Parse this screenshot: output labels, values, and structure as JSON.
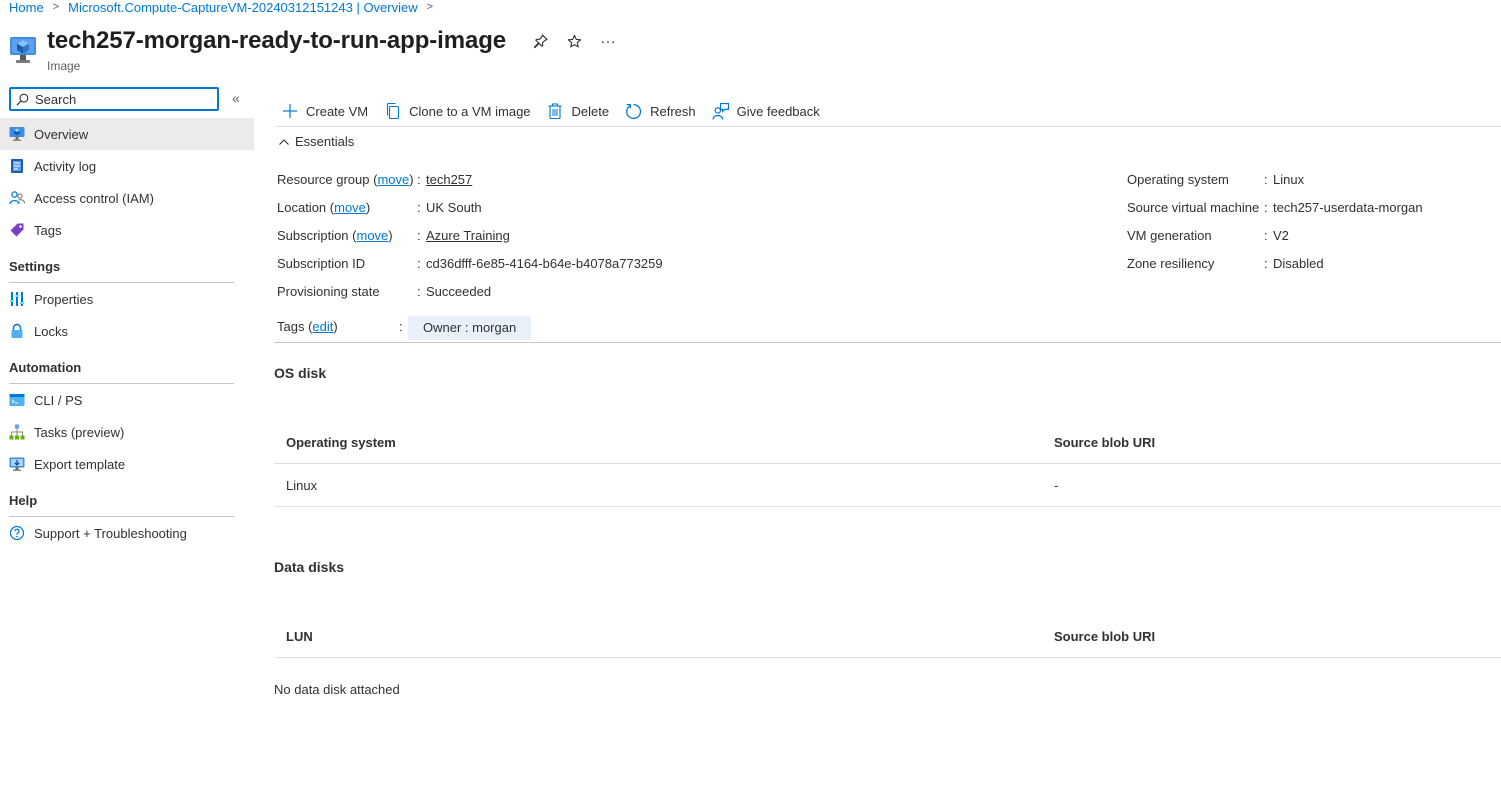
{
  "breadcrumb": [
    {
      "label": "Home"
    },
    {
      "label": "Microsoft.Compute-CaptureVM-20240312151243 | Overview"
    }
  ],
  "header": {
    "title": "tech257-morgan-ready-to-run-app-image",
    "subtitle": "Image",
    "pin_icon": "pin-icon",
    "favorite_icon": "star-icon",
    "more_label": "···"
  },
  "search": {
    "placeholder": "Search",
    "collapse_label": "«"
  },
  "sidebar": {
    "top_items": [
      {
        "label": "Overview",
        "icon": "image-icon",
        "active": true
      },
      {
        "label": "Activity log",
        "icon": "activity-log-icon"
      },
      {
        "label": "Access control (IAM)",
        "icon": "people-icon"
      },
      {
        "label": "Tags",
        "icon": "tag-icon"
      }
    ],
    "sections": [
      {
        "title": "Settings",
        "items": [
          {
            "label": "Properties",
            "icon": "properties-icon"
          },
          {
            "label": "Locks",
            "icon": "lock-icon"
          }
        ]
      },
      {
        "title": "Automation",
        "items": [
          {
            "label": "CLI / PS",
            "icon": "terminal-icon"
          },
          {
            "label": "Tasks (preview)",
            "icon": "tasks-icon"
          },
          {
            "label": "Export template",
            "icon": "export-template-icon"
          }
        ]
      },
      {
        "title": "Help",
        "items": [
          {
            "label": "Support + Troubleshooting",
            "icon": "help-icon"
          }
        ]
      }
    ]
  },
  "commands": [
    {
      "label": "Create VM",
      "icon": "plus-icon"
    },
    {
      "label": "Clone to a VM image",
      "icon": "copy-icon"
    },
    {
      "label": "Delete",
      "icon": "trash-icon"
    },
    {
      "label": "Refresh",
      "icon": "refresh-icon"
    },
    {
      "label": "Give feedback",
      "icon": "feedback-icon"
    }
  ],
  "essentials": {
    "toggle_label": "Essentials",
    "left": {
      "resource_group": {
        "label": "Resource group",
        "move": "move",
        "value": "tech257"
      },
      "location": {
        "label": "Location",
        "move": "move",
        "value": "UK South"
      },
      "subscription": {
        "label": "Subscription",
        "move": "move",
        "value": "Azure Training"
      },
      "subscription_id": {
        "label": "Subscription ID",
        "value": "cd36dfff-6e85-4164-b64e-b4078a773259"
      },
      "provisioning_state": {
        "label": "Provisioning state",
        "value": "Succeeded"
      }
    },
    "right": [
      {
        "label": "Operating system",
        "value": "Linux"
      },
      {
        "label": "Source virtual machine",
        "value": "tech257-userdata-morgan"
      },
      {
        "label": "VM generation",
        "value": "V2"
      },
      {
        "label": "Zone resiliency",
        "value": "Disabled"
      }
    ],
    "tags": {
      "label": "Tags",
      "edit": "edit",
      "chip": "Owner : morgan"
    },
    "colon": ":"
  },
  "os_disk": {
    "title": "OS disk",
    "columns": [
      "Operating system",
      "Source blob URI"
    ],
    "rows": [
      [
        "Linux",
        "-"
      ]
    ]
  },
  "data_disks": {
    "title": "Data disks",
    "columns": [
      "LUN",
      "Source blob URI"
    ],
    "empty_text": "No data disk attached"
  },
  "colors": {
    "accent": "#0078d4",
    "active_nav_bg": "#edebe9",
    "tag_bg": "#e8f1fb"
  }
}
